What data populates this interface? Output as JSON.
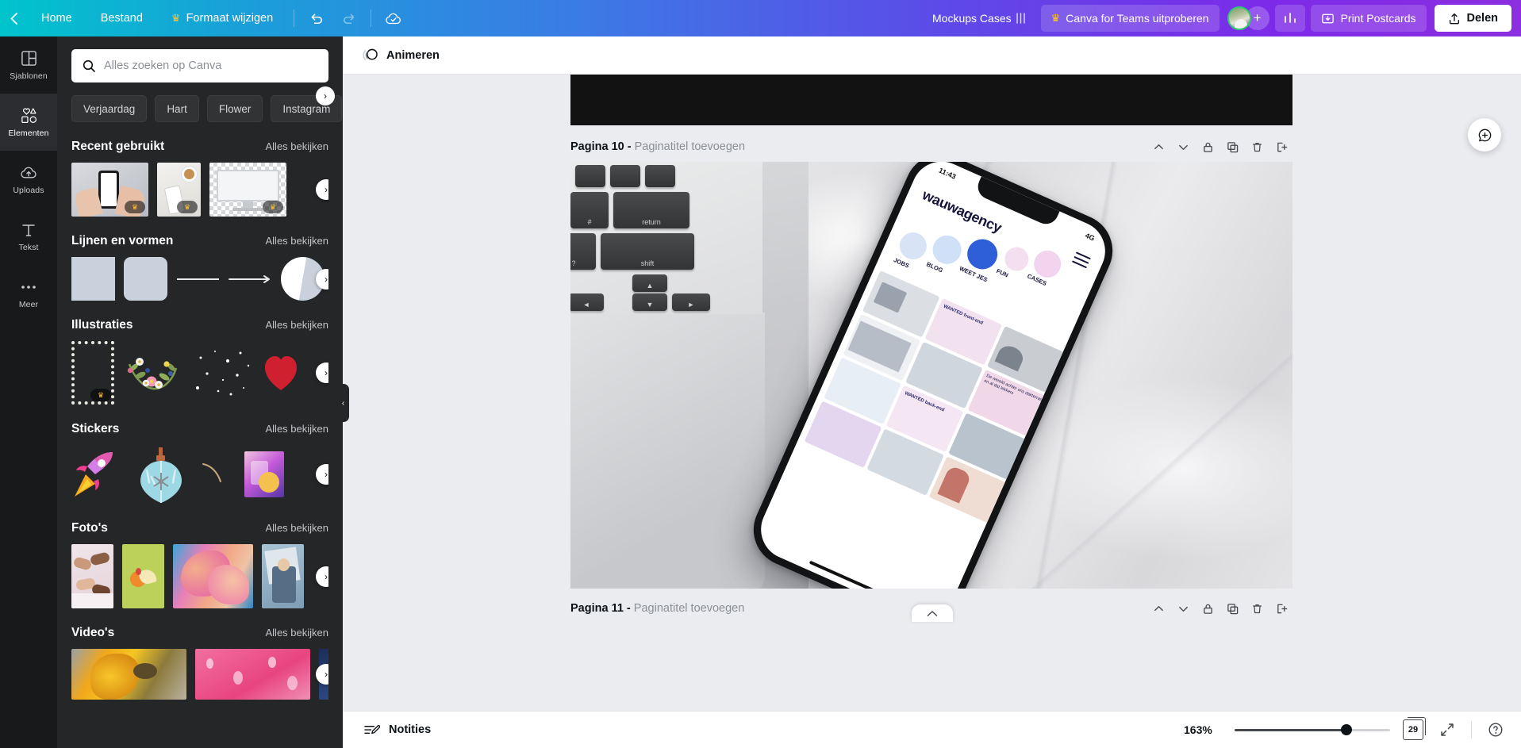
{
  "topbar": {
    "back_icon": "chevron-left-icon",
    "home": "Home",
    "file": "Bestand",
    "resize": "Formaat wijzigen",
    "resize_crown": "♛",
    "undo_icon": "undo-icon",
    "redo_icon": "redo-icon",
    "cloud_icon": "cloud-saved-icon",
    "doc_title": "Mockups Cases",
    "teams_cta": "Canva for Teams uitproberen",
    "teams_crown": "♛",
    "plus": "+",
    "stats_icon": "bar-chart-icon",
    "print_postcards": "Print Postcards",
    "share": "Delen",
    "accent": "#7d2ae8"
  },
  "rail": {
    "items": [
      {
        "label": "Sjablonen",
        "icon": "templates-icon",
        "active": false
      },
      {
        "label": "Elementen",
        "icon": "elements-icon",
        "active": true
      },
      {
        "label": "Uploads",
        "icon": "upload-cloud-icon",
        "active": false
      },
      {
        "label": "Tekst",
        "icon": "text-icon",
        "active": false
      },
      {
        "label": "Meer",
        "icon": "more-dots-icon",
        "active": false
      }
    ]
  },
  "panel": {
    "search_placeholder": "Alles zoeken op Canva",
    "search_value": "",
    "search_icon": "search-icon",
    "tags": [
      "Verjaardag",
      "Hart",
      "Flower",
      "Instagram"
    ],
    "see_all": "Alles bekijken",
    "sections": [
      {
        "title": "Recent gebruikt",
        "see_all": "Alles bekijken"
      },
      {
        "title": "Lijnen en vormen",
        "see_all": "Alles bekijken"
      },
      {
        "title": "Illustraties",
        "see_all": "Alles bekijken"
      },
      {
        "title": "Stickers",
        "see_all": "Alles bekijken"
      },
      {
        "title": "Foto's",
        "see_all": "Alles bekijken"
      },
      {
        "title": "Video's",
        "see_all": "Alles bekijken"
      }
    ]
  },
  "editor_toolbar": {
    "animate": "Animeren",
    "animate_icon": "animate-icon"
  },
  "canvas": {
    "page_label_number": "Pagina 10 -",
    "page_label_placeholder": "Paginatitel toevoegen",
    "next_page_number": "Pagina 11 -",
    "next_page_placeholder": "Paginatitel toevoegen",
    "tools": [
      {
        "icon": "move-up-icon",
        "name": "move-page-up"
      },
      {
        "icon": "move-down-icon",
        "name": "move-page-down"
      },
      {
        "icon": "lock-icon",
        "name": "lock-page"
      },
      {
        "icon": "duplicate-icon",
        "name": "duplicate-page"
      },
      {
        "icon": "trash-icon",
        "name": "delete-page"
      },
      {
        "icon": "add-page-icon",
        "name": "add-page"
      }
    ],
    "comment_icon": "comment-add-icon",
    "scroll_up_icon": "chevron-up-icon"
  },
  "phone_mockup": {
    "status_time": "11:43",
    "status_right": "4G",
    "brand": "wauwagency",
    "bubbles": [
      "JOBS",
      "BLOG",
      "WEET JES",
      "FUN",
      "CASES"
    ],
    "tiles": [
      "WANTED front-end",
      "WANTED back-end",
      "De wereld achter ons dakterras en al dat lekkers"
    ]
  },
  "bottombar": {
    "notes": "Notities",
    "notes_icon": "notes-icon",
    "zoom_level": "163%",
    "zoom_value": 72,
    "page_count": "29",
    "grid_icon": "page-grid-icon",
    "fullscreen_icon": "fullscreen-icon",
    "help_icon": "help-icon"
  }
}
